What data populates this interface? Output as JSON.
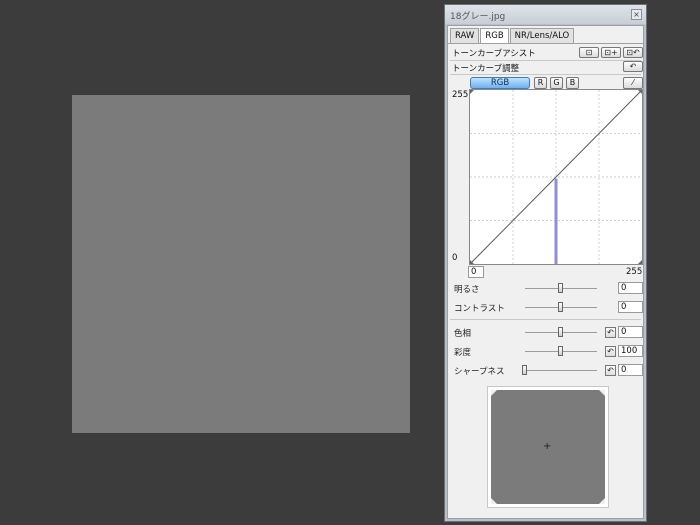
{
  "panel": {
    "title": "18グレー.jpg",
    "close_label": "×"
  },
  "tabs": [
    {
      "label": "RAW",
      "active": false
    },
    {
      "label": "RGB",
      "active": true
    },
    {
      "label": "NR/Lens/ALO",
      "active": false
    }
  ],
  "tone_assist": {
    "label": "トーンカーブアシスト",
    "buttons": [
      "⊡",
      "⊡+",
      "⊡↶"
    ]
  },
  "tone_adjust": {
    "label": "トーンカーブ調整",
    "reset_label": "↶"
  },
  "channels": {
    "rgb": "RGB",
    "r": "R",
    "g": "G",
    "b": "B",
    "eyedropper": "⁄"
  },
  "curve": {
    "y_max": "255",
    "y_min": "0",
    "input_value": "0",
    "x_max": "255",
    "histogram_color": "#8f8fd6",
    "histogram_level": 0.5,
    "histogram_peak": 0.49
  },
  "sliders": {
    "brightness": {
      "label": "明るさ",
      "value": "0",
      "position": 0.5
    },
    "contrast": {
      "label": "コントラスト",
      "value": "0",
      "position": 0.5
    },
    "hue": {
      "label": "色相",
      "value": "0",
      "position": 0.5
    },
    "saturation": {
      "label": "彩度",
      "value": "100",
      "position": 0.5
    },
    "sharpness": {
      "label": "シャープネス",
      "value": "0",
      "position": 0.0
    }
  },
  "colors": {
    "image_gray": "#7b7b7b",
    "background": "#3c3c3c",
    "accent": "#6eb2ee"
  }
}
